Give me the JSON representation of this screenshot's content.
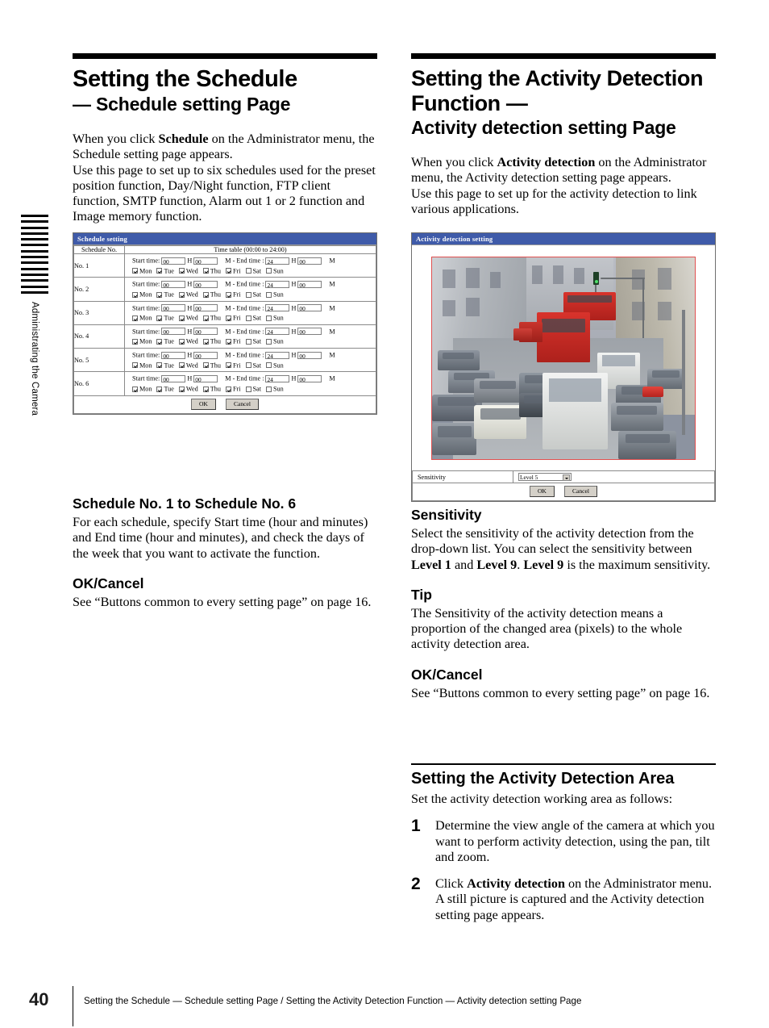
{
  "side_tab": {
    "label": "Administrating the Camera",
    "stripe_count": 14
  },
  "left_column": {
    "title_main": "Setting the Schedule",
    "title_sub": "— Schedule setting Page",
    "intro_1_a": "When you click ",
    "intro_1_b": "Schedule",
    "intro_1_c": " on the Administrator menu, the Schedule setting page appears.",
    "intro_2": "Use this page to set up to six schedules used for the preset position function, Day/Night function, FTP client function, SMTP function, Alarm out 1 or 2 function and Image memory function.",
    "section_1_heading": "Schedule No. 1 to Schedule No. 6",
    "section_1_body": "For each schedule, specify Start time (hour and minutes) and End time (hour and minutes), and check the days of the week that you want to activate the function.",
    "section_2_heading": "OK/Cancel",
    "section_2_body": "See “Buttons common to every setting page” on page 16."
  },
  "right_column": {
    "title_main": "Setting the Activity Detection Function —",
    "title_sub": "Activity detection setting Page",
    "intro_1_a": "When you click ",
    "intro_1_b": "Activity detection",
    "intro_1_c": " on the Administrator menu, the Activity detection setting page appears.",
    "intro_2": "Use this page to set up for the activity detection to link various applications.",
    "sensitivity_heading": "Sensitivity",
    "sensitivity_body_a": "Select the sensitivity of the activity detection from the drop-down list.  You can select the sensitivity between ",
    "sensitivity_body_b": "Level 1",
    "sensitivity_body_c": " and ",
    "sensitivity_body_d": "Level 9",
    "sensitivity_body_e": ".  ",
    "sensitivity_body_f": "Level 9",
    "sensitivity_body_g": " is the maximum sensitivity.",
    "tip_heading": "Tip",
    "tip_body": "The Sensitivity of the activity detection means a proportion of the changed area (pixels) to the whole activity detection area.",
    "okcancel_heading": "OK/Cancel",
    "okcancel_body": "See “Buttons common to every setting page” on page 16.",
    "area_heading": "Setting the Activity Detection Area",
    "area_intro": "Set the activity detection working area as follows:",
    "steps": [
      {
        "number": "1",
        "text": "Determine the view angle of the camera at which you want to perform activity detection, using the pan, tilt and zoom."
      },
      {
        "number": "2",
        "text_a": "Click ",
        "text_b": "Activity detection",
        "text_c": " on the Administrator menu.",
        "text_d": "A still picture is captured and the Activity detection setting page appears."
      }
    ]
  },
  "schedule_panel": {
    "title": "Schedule setting",
    "header_col_1": "Schedule No.",
    "header_col_2": "Time table (00:00 to 24:00)",
    "labels": {
      "start_time": "Start time:",
      "h": "H",
      "m_dash_end": "M - End time :",
      "m": "M"
    },
    "days": [
      "Mon",
      "Tue",
      "Wed",
      "Thu",
      "Fri",
      "Sat",
      "Sun"
    ],
    "rows": [
      {
        "name": "No. 1",
        "start_h": "00",
        "start_m": "00",
        "end_h": "24",
        "end_m": "00",
        "checked": [
          true,
          true,
          true,
          true,
          true,
          false,
          false
        ]
      },
      {
        "name": "No. 2",
        "start_h": "00",
        "start_m": "00",
        "end_h": "24",
        "end_m": "00",
        "checked": [
          true,
          true,
          true,
          true,
          true,
          false,
          false
        ]
      },
      {
        "name": "No. 3",
        "start_h": "00",
        "start_m": "00",
        "end_h": "24",
        "end_m": "00",
        "checked": [
          true,
          true,
          true,
          true,
          true,
          false,
          false
        ]
      },
      {
        "name": "No. 4",
        "start_h": "00",
        "start_m": "00",
        "end_h": "24",
        "end_m": "00",
        "checked": [
          true,
          true,
          true,
          true,
          true,
          false,
          false
        ]
      },
      {
        "name": "No. 5",
        "start_h": "00",
        "start_m": "00",
        "end_h": "24",
        "end_m": "00",
        "checked": [
          true,
          true,
          true,
          true,
          true,
          false,
          false
        ]
      },
      {
        "name": "No. 6",
        "start_h": "00",
        "start_m": "00",
        "end_h": "24",
        "end_m": "00",
        "checked": [
          true,
          true,
          true,
          true,
          true,
          false,
          false
        ]
      }
    ],
    "ok_label": "OK",
    "cancel_label": "Cancel"
  },
  "activity_panel": {
    "title": "Activity detection setting",
    "sensitivity_label": "Sensitivity",
    "sensitivity_value": "Level 5",
    "ok_label": "OK",
    "cancel_label": "Cancel",
    "image_description": "Busy city street with traffic, red double-decker buses and cars"
  },
  "footer": {
    "page_number": "40",
    "running_title": "Setting the Schedule — Schedule setting Page / Setting the Activity Detection Function — Activity detection setting Page"
  },
  "colors": {
    "titlebar_blue": "#3f5ba9",
    "image_border_red": "#e05050",
    "button_face": "#d4d0c8"
  }
}
